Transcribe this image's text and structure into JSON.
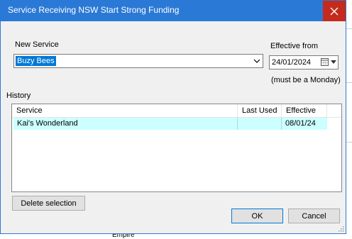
{
  "window": {
    "title": "Service Receiving NSW Start Strong Funding"
  },
  "new_service": {
    "label": "New Service",
    "value": "Buzy Bees"
  },
  "effective_from": {
    "label": "Effective from",
    "value": "24/01/2024",
    "note": "(must be a Monday)"
  },
  "history": {
    "label": "History",
    "columns": [
      "Service",
      "Last Used",
      "Effective"
    ],
    "rows": [
      {
        "service": "Kai's Wonderland",
        "last_used": "",
        "effective": "08/01/24"
      }
    ]
  },
  "buttons": {
    "delete_selection": "Delete selection",
    "ok": "OK",
    "cancel": "Cancel"
  },
  "background": {
    "bottom_text": "Empire"
  },
  "colors": {
    "titlebar": "#2b79d6",
    "close_button": "#c42b1c",
    "selected_row": "#ccffff",
    "selection_highlight": "#0078d7"
  }
}
